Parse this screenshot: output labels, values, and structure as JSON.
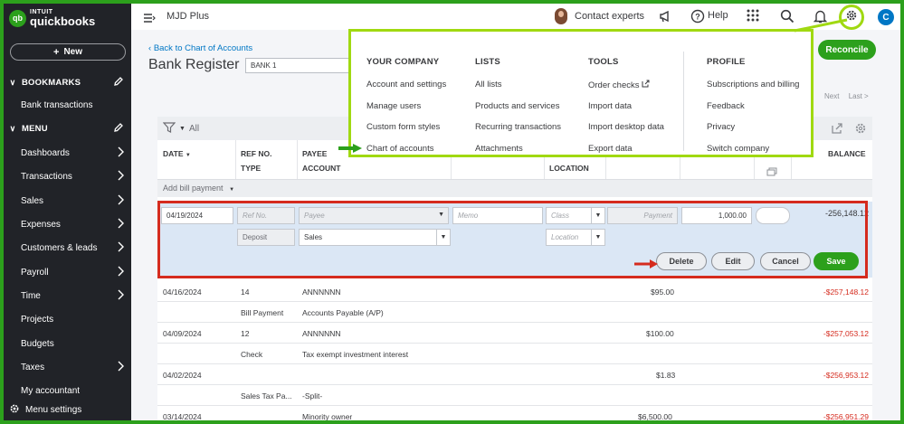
{
  "brand": {
    "badge": "qb",
    "intuit": "INTUIT",
    "name": "quickbooks"
  },
  "sidebar": {
    "new_label": "New",
    "bookmarks_label": "BOOKMARKS",
    "bank_transactions": "Bank transactions",
    "menu_label": "MENU",
    "items": [
      {
        "label": "Dashboards",
        "arrow": true
      },
      {
        "label": "Transactions",
        "arrow": true
      },
      {
        "label": "Sales",
        "arrow": true
      },
      {
        "label": "Expenses",
        "arrow": true
      },
      {
        "label": "Customers & leads",
        "arrow": true
      },
      {
        "label": "Payroll",
        "arrow": true
      },
      {
        "label": "Time",
        "arrow": true
      },
      {
        "label": "Projects",
        "arrow": false
      },
      {
        "label": "Budgets",
        "arrow": false
      },
      {
        "label": "Taxes",
        "arrow": true
      },
      {
        "label": "My accountant",
        "arrow": false
      }
    ],
    "menu_settings": "Menu settings"
  },
  "topbar": {
    "company": "MJD Plus",
    "contact_experts": "Contact experts",
    "help": "Help",
    "user_initial": "C"
  },
  "page": {
    "back_link": "Back to Chart of Accounts",
    "title": "Bank Register",
    "account": "BANK 1",
    "reconcile": "Reconcile",
    "pager_next": "Next",
    "pager_last": "Last >",
    "filter_all": "All"
  },
  "columns": {
    "date": "DATE",
    "ref_no": "REF NO.",
    "type": "TYPE",
    "payee": "PAYEE",
    "account": "ACCOUNT",
    "location": "LOCATION",
    "balance": "BALANCE"
  },
  "add_bill_payment": "Add bill payment",
  "edit_row": {
    "date": "04/19/2024",
    "ref_placeholder": "Ref No.",
    "payee_placeholder": "Payee",
    "memo_placeholder": "Memo",
    "class_placeholder": "Class",
    "payment_placeholder": "Payment",
    "deposit_value": "1,000.00",
    "balance": "-256,148.12",
    "type": "Deposit",
    "account": "Sales",
    "location_placeholder": "Location",
    "delete": "Delete",
    "edit": "Edit",
    "cancel": "Cancel",
    "save": "Save"
  },
  "rows": [
    {
      "date": "04/16/2024",
      "ref": "14",
      "payee": "ANNNNNN",
      "payment": "$95.00",
      "balance": "-$257,148.12",
      "type": "Bill Payment",
      "account": "Accounts Payable (A/P)"
    },
    {
      "date": "04/09/2024",
      "ref": "12",
      "payee": "ANNNNNN",
      "payment": "$100.00",
      "balance": "-$257,053.12",
      "type": "Check",
      "account": "Tax exempt investment interest"
    },
    {
      "date": "04/02/2024",
      "ref": "",
      "payee": "",
      "payment": "$1.83",
      "balance": "-$256,953.12",
      "type": "Sales Tax Pa...",
      "account": "-Split-"
    },
    {
      "date": "03/14/2024",
      "ref": "",
      "payee": "Minority owner",
      "payment": "$6,500.00",
      "balance": "-$256,951.29",
      "type": "",
      "account": ""
    }
  ],
  "gear_menu": {
    "your_company": {
      "heading": "YOUR COMPANY",
      "items": [
        "Account and settings",
        "Manage users",
        "Custom form styles",
        "Chart of accounts"
      ]
    },
    "lists": {
      "heading": "LISTS",
      "items": [
        "All lists",
        "Products and services",
        "Recurring transactions",
        "Attachments"
      ]
    },
    "tools": {
      "heading": "TOOLS",
      "items": [
        "Order checks",
        "Import data",
        "Import desktop data",
        "Export data"
      ]
    },
    "profile": {
      "heading": "PROFILE",
      "items": [
        "Subscriptions and billing",
        "Feedback",
        "Privacy",
        "Switch company"
      ]
    }
  },
  "colors": {
    "brand_green": "#2ca01c",
    "highlight_lime": "#a0d911",
    "annotation_red": "#d52b1e",
    "sidebar_bg": "#212328",
    "link_blue": "#0077c5"
  }
}
